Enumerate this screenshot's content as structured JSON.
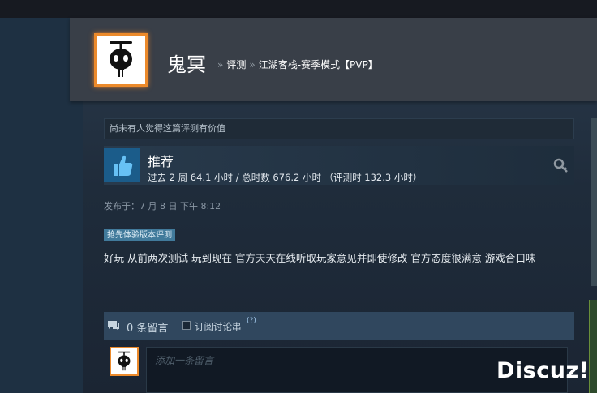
{
  "header": {
    "username": "鬼冥",
    "breadcrumb_sep": "»",
    "breadcrumb_reviews": "评测",
    "breadcrumb_game": "江湖客栈-赛季模式【PVP】"
  },
  "review": {
    "helpful_text": "尚未有人觉得这篇评测有价值",
    "verdict": "推荐",
    "hours": "过去 2 周 64.1 小时 / 总时数 676.2 小时 （评测时 132.3 小时）",
    "posted": "发布于：7 月 8 日 下午 8:12",
    "early_access_badge": "抢先体验版本评测",
    "body": "好玩 从前两次测试 玩到现在 官方天天在线听取玩家意见并即使修改 官方态度很满意 游戏合口味"
  },
  "comments": {
    "count_label": "0 条留言",
    "subscribe_label": "订阅讨论串",
    "help_mark": "(?)",
    "input_placeholder": "添加一条留言"
  },
  "watermark": "Discuz!",
  "colors": {
    "accent_orange": "#ec8a2b",
    "thumb_blue": "#1b5c8a",
    "badge_blue": "#417a9b"
  }
}
